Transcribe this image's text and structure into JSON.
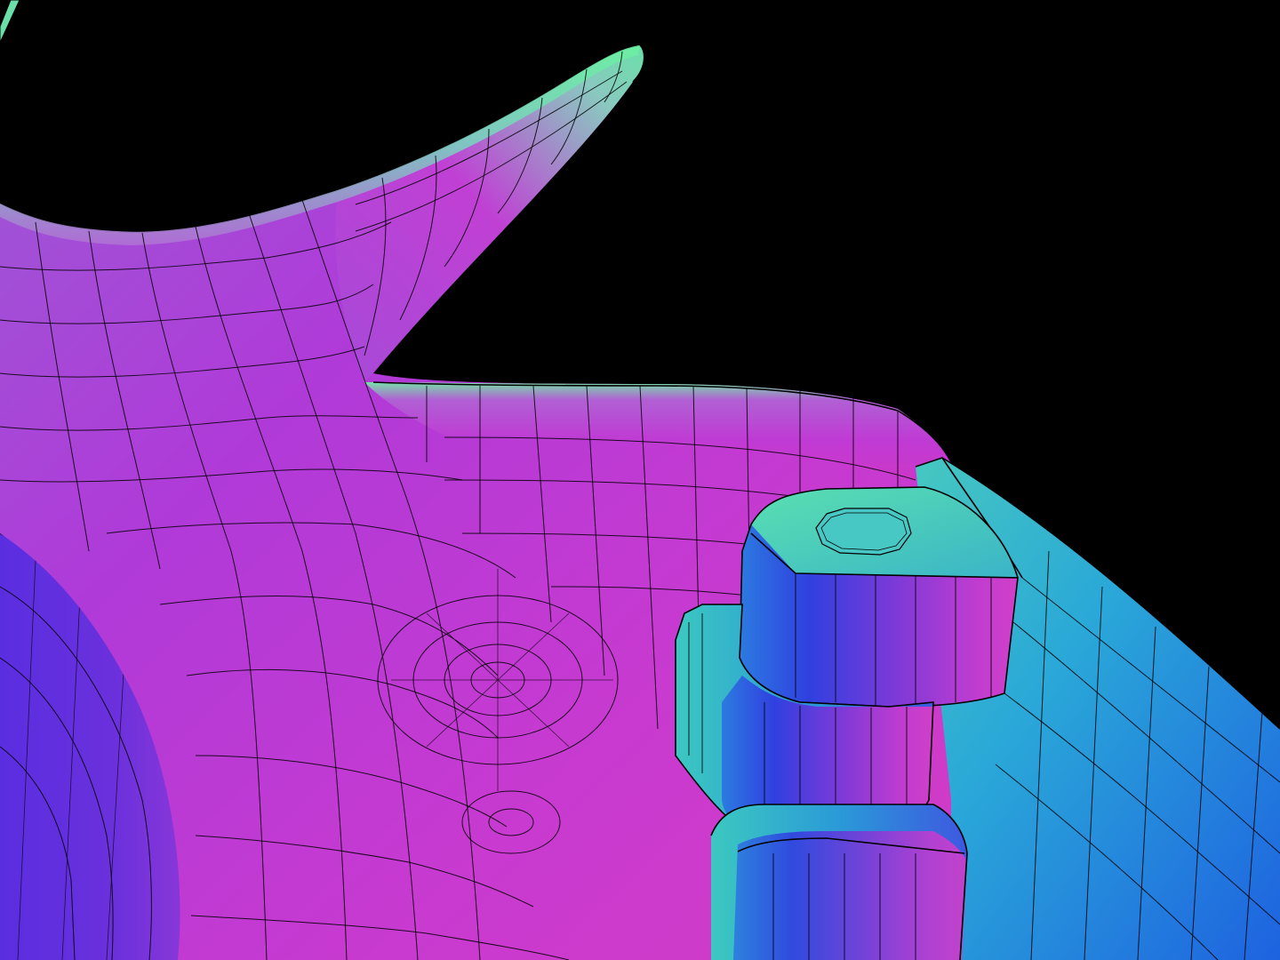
{
  "scene": {
    "background_color": "#000000",
    "render_style": "normal-map shaded wireframe",
    "colors": {
      "magenta": "#c23cd6",
      "violet": "#8a46d8",
      "indigo": "#5a2ee0",
      "teal": "#4fd6b0",
      "cyan": "#2aa8d8",
      "blue": "#2266e0",
      "green_highlight": "#6cf0a0"
    }
  }
}
